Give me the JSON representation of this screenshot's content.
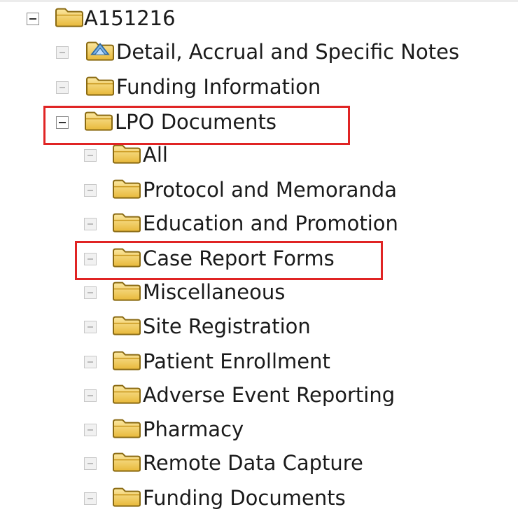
{
  "tree": {
    "root": {
      "label": "A151216",
      "expanded": true
    },
    "children": [
      {
        "label": "Detail, Accrual and Specific Notes",
        "icon": "notes-folder-icon",
        "expanded": false
      },
      {
        "label": "Funding Information",
        "icon": "folder-icon",
        "expanded": false
      },
      {
        "label": "LPO Documents",
        "icon": "folder-icon",
        "expanded": true,
        "highlighted": true,
        "children": [
          {
            "label": "All",
            "expanded": false
          },
          {
            "label": "Protocol and Memoranda",
            "expanded": false
          },
          {
            "label": "Education and Promotion",
            "expanded": false
          },
          {
            "label": "Case Report Forms",
            "expanded": false,
            "highlighted": true
          },
          {
            "label": "Miscellaneous",
            "expanded": false
          },
          {
            "label": "Site Registration",
            "expanded": false
          },
          {
            "label": "Patient Enrollment",
            "expanded": false
          },
          {
            "label": "Adverse Event Reporting",
            "expanded": false
          },
          {
            "label": "Pharmacy",
            "expanded": false
          },
          {
            "label": "Remote Data Capture",
            "expanded": false
          },
          {
            "label": "Funding Documents",
            "expanded": false
          }
        ]
      }
    ]
  },
  "colors": {
    "highlight_border": "#e02424",
    "folder_fill": "#f2cf63",
    "folder_outline": "#8a6a12"
  }
}
